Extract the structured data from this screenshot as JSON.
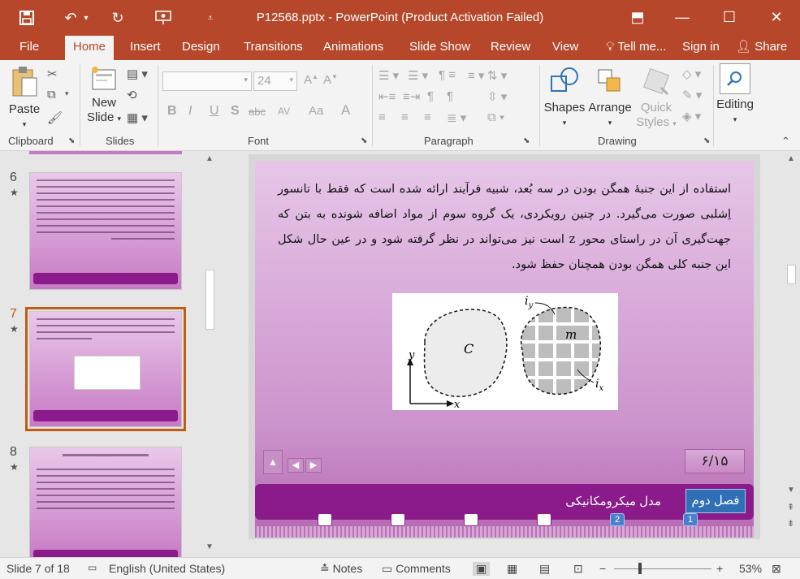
{
  "window": {
    "title": "P12568.pptx - PowerPoint (Product Activation Failed)",
    "minimize": "—",
    "maximize": "☐",
    "close": "✕",
    "ribbon_display": "⬒"
  },
  "quick_access": {
    "save_icon": "save-icon",
    "undo_icon": "undo-icon",
    "redo_icon": "redo-icon",
    "slideshow_icon": "present-icon",
    "customize_icon": "customize-icon"
  },
  "tabs": [
    "File",
    "Home",
    "Insert",
    "Design",
    "Transitions",
    "Animations",
    "Slide Show",
    "Review",
    "View"
  ],
  "tell_me": "Tell me...",
  "sign_in": "Sign in",
  "share": "Share",
  "ribbon": {
    "clipboard": {
      "label": "Clipboard",
      "paste": "Paste"
    },
    "slides": {
      "label": "Slides",
      "new_slide_1": "New",
      "new_slide_2": "Slide"
    },
    "font": {
      "label": "Font",
      "font_name": "",
      "font_size": "24",
      "bold": "B",
      "italic": "I",
      "underline": "U",
      "shadow": "S",
      "strike": "abc",
      "spacing": "AV",
      "case": "Aa",
      "color": "A"
    },
    "paragraph": {
      "label": "Paragraph"
    },
    "drawing": {
      "label": "Drawing",
      "shapes": "Shapes",
      "arrange": "Arrange",
      "quick_styles_1": "Quick",
      "quick_styles_2": "Styles"
    },
    "editing": {
      "label": "Editing"
    }
  },
  "thumbnails": [
    {
      "number": "6",
      "star": "★",
      "selected": false
    },
    {
      "number": "7",
      "star": "★",
      "selected": true
    },
    {
      "number": "8",
      "star": "★",
      "selected": false
    }
  ],
  "slide": {
    "body_text": "استفاده از این جنبهٔ همگن بودن در سه بُعد، شبیه فرآیند ارائه شده است که فقط با تانسور اِشلبی صورت می‌گیرد. در چنین رویکردی، یک گروه سوم از مواد اضافه شونده به بتن که جهت‌گیری آن در راستای محور z است نیز می‌تواند در نظر گرفته شود و در عین حال شکل این جنبه کلی همگن بودن همچنان حفظ شود.",
    "figure": {
      "label_c": "C",
      "label_m": "m",
      "label_iy": "i",
      "label_iy_sub": "y",
      "label_ix": "i",
      "label_ix_sub": "x",
      "axis_x": "x",
      "axis_y": "y"
    },
    "page_number": "۶/۱۵",
    "chapter": "فصل دوم",
    "footer_title": "مدل میکرومکانیکی",
    "dots": [
      "",
      "",
      "",
      "",
      "2",
      "1"
    ]
  },
  "status": {
    "slide_of": "Slide 7 of 18",
    "language": "English (United States)",
    "notes": "Notes",
    "comments": "Comments",
    "zoom": "53%",
    "zoom_level": 0.53
  }
}
